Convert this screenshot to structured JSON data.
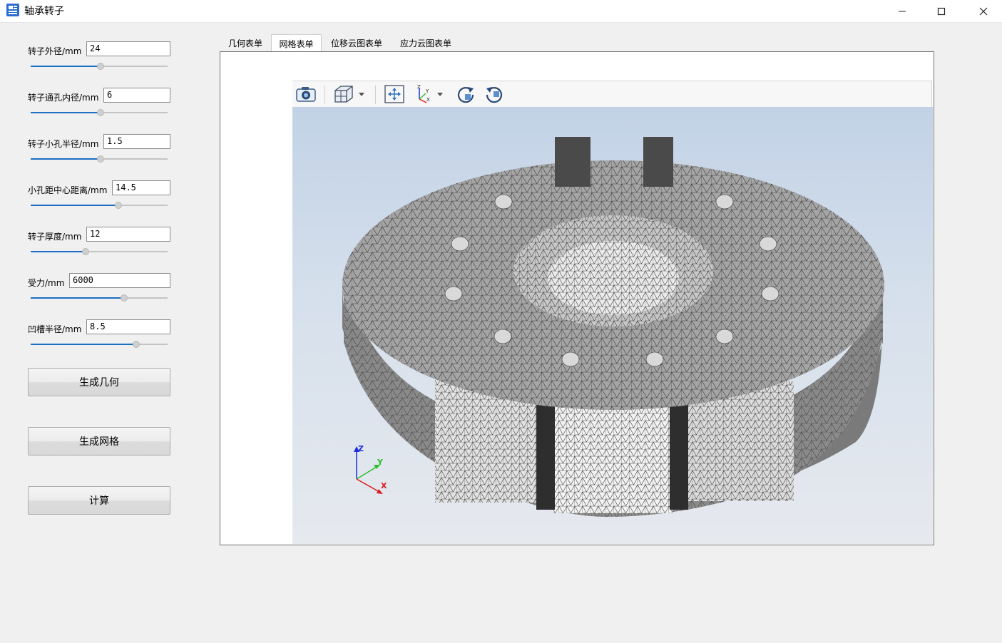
{
  "window": {
    "title": "轴承转子"
  },
  "params": [
    {
      "label": "转子外径/mm",
      "value": "24",
      "slider": 0.51
    },
    {
      "label": "转子通孔内径/mm",
      "value": "6",
      "slider": 0.51
    },
    {
      "label": "转子小孔半径/mm",
      "value": "1.5",
      "slider": 0.51
    },
    {
      "label": "小孔距中心距离/mm",
      "value": "14.5",
      "slider": 0.64
    },
    {
      "label": "转子厚度/mm",
      "value": "12",
      "slider": 0.4
    },
    {
      "label": "受力/mm",
      "value": "6000",
      "slider": 0.68
    },
    {
      "label": "凹槽半径/mm",
      "value": "8.5",
      "slider": 0.77
    }
  ],
  "buttons": {
    "generate_geometry": "生成几何",
    "generate_mesh": "生成网格",
    "compute": "计算"
  },
  "tabs": [
    {
      "label": "几何表单",
      "active": false
    },
    {
      "label": "网格表单",
      "active": true
    },
    {
      "label": "位移云图表单",
      "active": false
    },
    {
      "label": "应力云图表单",
      "active": false
    }
  ],
  "viewer": {
    "tools": [
      "camera-icon",
      "cube-view-icon",
      "fit-view-icon",
      "axes-orientation-icon",
      "rotate-cw-icon",
      "rotate-ccw-icon"
    ],
    "triad": {
      "x": "X",
      "y": "Y",
      "z": "Z"
    },
    "colors": {
      "accent": "#1c6fc5",
      "axis_x": "#e01b1b",
      "axis_y": "#2bbf2b",
      "axis_z": "#1a2ee0"
    }
  }
}
